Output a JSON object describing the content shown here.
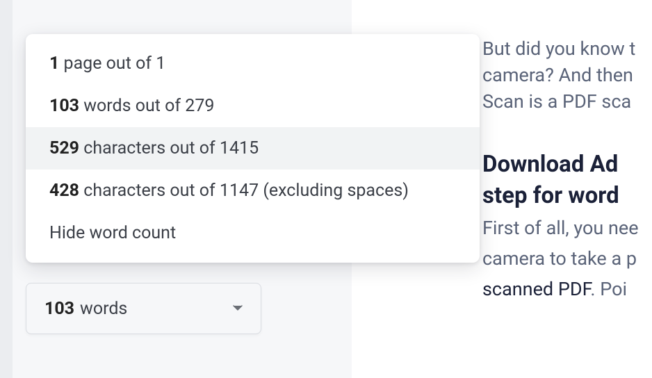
{
  "popup": {
    "pages_bold": "1",
    "pages_rest": " page out of 1",
    "words_bold": "103",
    "words_rest": " words out of 279",
    "chars_bold": "529",
    "chars_rest": " characters out of 1415",
    "chars_ns_bold": "428",
    "chars_ns_rest": " characters out of 1147 (excluding spaces)",
    "hide": "Hide word count"
  },
  "button": {
    "bold": "103",
    "rest": "words"
  },
  "doc": {
    "p1_l1": "But did you know t",
    "p1_l2": "camera? And then",
    "p1_l3": "Scan is a PDF sca",
    "h_l1": "Download Ad",
    "h_l2": "step for word",
    "p2_l1": "First of all, you nee",
    "p2_l2": "camera to take a p",
    "p2_l3a": "scanned PDF",
    "p2_l3b": ". Poi"
  }
}
